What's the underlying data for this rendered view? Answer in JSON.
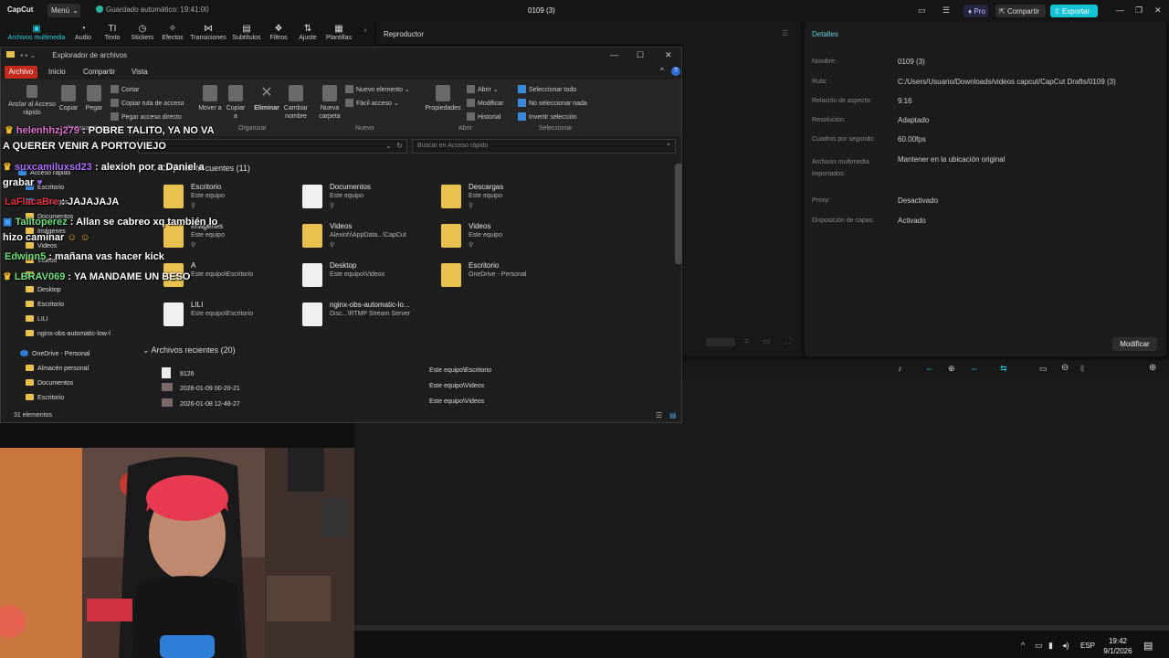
{
  "app": {
    "logo": "CapCut",
    "menu": "Menú",
    "autosave": "Guardado automático: 19:41:00",
    "title": "0109 (3)",
    "pro": "Pro",
    "share": "Compartir",
    "export": "Exportar"
  },
  "toolbar": [
    "Archivos multimedia",
    "Audio",
    "Texto",
    "Stickers",
    "Efectos",
    "Transiciones",
    "Subtítulos",
    "Filtros",
    "Ajuste",
    "Plantillas"
  ],
  "player": {
    "title": "Reproductor"
  },
  "details": {
    "title": "Detalles",
    "rows": [
      {
        "label": "Nombre:",
        "value": "0109 (3)"
      },
      {
        "label": "Ruta:",
        "value": "C:/Users/Usuario/Downloads/videos capcut/CapCut Drafts/0109 (3)"
      },
      {
        "label": "Relación de aspecto:",
        "value": "9:16"
      },
      {
        "label": "Resolución:",
        "value": "Adaptado"
      },
      {
        "label": "Cuadros por segundo:",
        "value": "60.00fps"
      },
      {
        "label": "Archivos multimedia importados:",
        "value": "Mantener en la ubicación original"
      },
      {
        "label": "Proxy:",
        "value": "Desactivado"
      },
      {
        "label": "Disposición de capas:",
        "value": "Activado"
      }
    ],
    "modify": "Modificar"
  },
  "explorer": {
    "title": "Explorador de archivos",
    "tabs": {
      "file": "Archivo",
      "home": "Inicio",
      "share": "Compartir",
      "view": "Vista"
    },
    "ribbon": {
      "pin": "Anclar al Acceso rápido",
      "copy": "Copiar",
      "paste": "Pegar",
      "cut": "Cortar",
      "copy_path": "Copiar ruta de acceso",
      "paste_shortcut": "Pegar acceso directo",
      "move": "Mover a",
      "copy_to": "Copiar a",
      "delete": "Eliminar",
      "rename": "Cambiar nombre",
      "new_folder": "Nueva carpeta",
      "new_item": "Nuevo elemento",
      "easy_access": "Fácil acceso",
      "properties": "Propiedades",
      "open": "Abrir",
      "edit": "Modificar",
      "history": "Historial",
      "select_all": "Seleccionar todo",
      "select_none": "No seleccionar nada",
      "invert": "Invertir selección",
      "groups": {
        "clipboard": "Portapapeles",
        "organize": "Organizar",
        "new": "Nuevo",
        "open": "Abrir",
        "select": "Seleccionar"
      }
    },
    "search_placeholder": "Buscar en Acceso rápido",
    "nav": [
      "Acceso rápido",
      "Escritorio",
      "Descargas",
      "Documentos",
      "Imágenes",
      "Videos",
      "Videos",
      "A",
      "Desktop",
      "Escritorio",
      "LILI",
      "nginx-obs-automatic-low-l",
      "OneDrive - Personal",
      "Almacén personal",
      "Documentos",
      "Escritorio"
    ],
    "frequent_title": "Carpetas frecuentes (11)",
    "frequent": [
      {
        "name": "Escritorio",
        "sub": "Este equipo"
      },
      {
        "name": "Documentos",
        "sub": "Este equipo"
      },
      {
        "name": "Descargas",
        "sub": "Este equipo"
      },
      {
        "name": "Imágenes",
        "sub": "Este equipo"
      },
      {
        "name": "Videos",
        "sub": "Alexioh\\AppData...\\CapCut"
      },
      {
        "name": "Videos",
        "sub": "Este equipo"
      },
      {
        "name": "A",
        "sub": "Este equipo\\Escritorio"
      },
      {
        "name": "Desktop",
        "sub": "Este equipo\\Videos"
      },
      {
        "name": "Escritorio",
        "sub": "OneDrive - Personal"
      },
      {
        "name": "LILI",
        "sub": "Este equipo\\Escritorio"
      },
      {
        "name": "nginx-obs-automatic-lo...",
        "sub": "Disc...\\RTMP Stream Server"
      }
    ],
    "recent_title": "Archivos recientes (20)",
    "recent": [
      {
        "name": "8126",
        "loc": "Este equipo\\Escritorio"
      },
      {
        "name": "2026-01-09 00-20-21",
        "loc": "Este equipo\\Videos"
      },
      {
        "name": "2026-01-08 12-48-27",
        "loc": "Este equipo\\Videos"
      }
    ],
    "status": "31 elementos"
  },
  "chat": [
    {
      "user": "helenhhzj279",
      "msg": ": POBRE TALITO, YA NO VA",
      "color": "#e06fd0"
    },
    {
      "user": "",
      "msg": "A QUERER VENIR A PORTOVIEJO",
      "color": "#ffffff"
    },
    {
      "user": "suxcamiluxsd23",
      "msg": ": alexioh por a Daniel a",
      "color": "#b070ff"
    },
    {
      "user": "",
      "msg": "grabar",
      "color": "#ffffff"
    },
    {
      "user": "LaFlacaBre",
      "msg": ": JAJAJAJA",
      "color": "#e03040"
    },
    {
      "user": "Talitoperez",
      "msg": ": Allan se cabreo xq también lo",
      "color": "#70e080"
    },
    {
      "user": "",
      "msg": "hizo caminar",
      "color": "#ffffff"
    },
    {
      "user": "Edwinn5",
      "msg": ": mañana vas hacer kick",
      "color": "#70e080"
    },
    {
      "user": "LBRAV069",
      "msg": ": YA MANDAME UN BESO",
      "color": "#70e080"
    }
  ],
  "taskbar": {
    "lang": "ESP",
    "time": "19:42",
    "date": "9/1/2026"
  }
}
